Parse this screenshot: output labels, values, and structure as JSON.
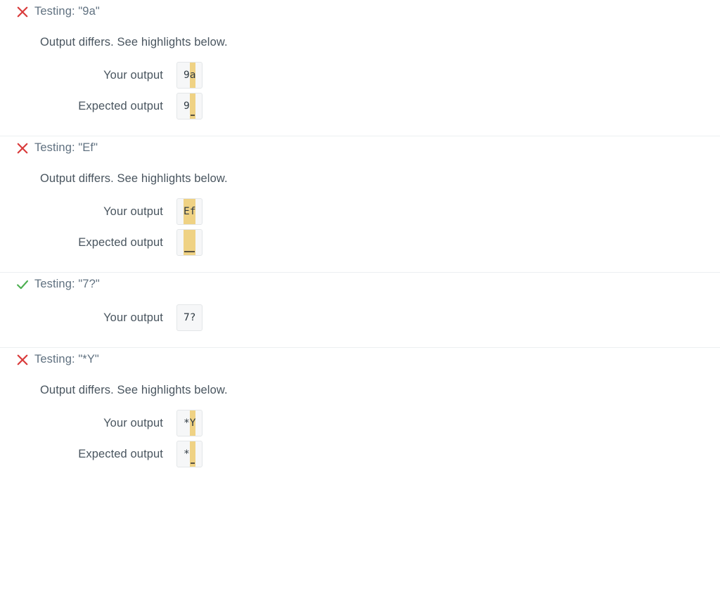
{
  "labels": {
    "your_output": "Your output",
    "expected_output": "Expected output",
    "diff_message": "Output differs. See highlights below."
  },
  "colors": {
    "fail_icon": "#d93b3b",
    "pass_icon": "#4caf50",
    "highlight": "#efd284",
    "box_background": "#f6f7f8",
    "box_border": "#e3e6e8",
    "title_text": "#607180",
    "body_text": "#49555f",
    "divider": "#eceff1"
  },
  "tests": [
    {
      "status": "fail",
      "status_icon": "x-icon",
      "title": "Testing: \"9a\"",
      "message": "Output differs. See highlights below.",
      "your_output": {
        "label": "Your output",
        "segments": [
          {
            "text": "9",
            "highlight": false,
            "blank_eol": false
          },
          {
            "text": "a",
            "highlight": true,
            "blank_eol": false
          }
        ]
      },
      "expected_output": {
        "label": "Expected output",
        "segments": [
          {
            "text": "9",
            "highlight": false,
            "blank_eol": false
          },
          {
            "text": " ",
            "highlight": true,
            "blank_eol": true
          }
        ]
      }
    },
    {
      "status": "fail",
      "status_icon": "x-icon",
      "title": "Testing: \"Ef\"",
      "message": "Output differs. See highlights below.",
      "your_output": {
        "label": "Your output",
        "segments": [
          {
            "text": "Ef",
            "highlight": true,
            "blank_eol": false
          }
        ]
      },
      "expected_output": {
        "label": "Expected output",
        "segments": [
          {
            "text": "  ",
            "highlight": true,
            "blank_eol": true
          }
        ]
      }
    },
    {
      "status": "pass",
      "status_icon": "check-icon",
      "title": "Testing: \"7?\"",
      "message": "",
      "your_output": {
        "label": "Your output",
        "segments": [
          {
            "text": "7?",
            "highlight": false,
            "blank_eol": false
          }
        ]
      },
      "expected_output": null
    },
    {
      "status": "fail",
      "status_icon": "x-icon",
      "title": "Testing: \"*Y\"",
      "message": "Output differs. See highlights below.",
      "your_output": {
        "label": "Your output",
        "segments": [
          {
            "text": "*",
            "highlight": false,
            "blank_eol": false
          },
          {
            "text": "Y",
            "highlight": true,
            "blank_eol": false
          }
        ]
      },
      "expected_output": {
        "label": "Expected output",
        "segments": [
          {
            "text": "*",
            "highlight": false,
            "blank_eol": false
          },
          {
            "text": " ",
            "highlight": true,
            "blank_eol": true
          }
        ]
      }
    }
  ]
}
